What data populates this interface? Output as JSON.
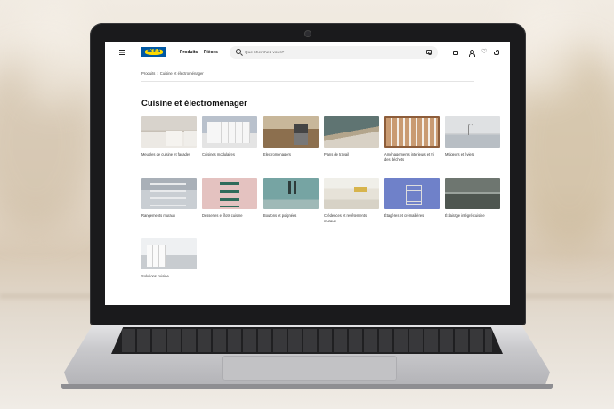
{
  "site": {
    "logo_text": "IKEA",
    "brand_colors": {
      "blue": "#0058a3",
      "yellow": "#ffdb00"
    },
    "nav": [
      {
        "label": "Produits"
      },
      {
        "label": "Pièces"
      }
    ],
    "search": {
      "placeholder": "Que cherchez-vous?"
    },
    "header_icons": [
      "truck-icon",
      "user-icon",
      "heart-icon",
      "shopping-bag-icon"
    ]
  },
  "breadcrumb": {
    "items": [
      "Produits",
      "Cuisine et électroménager"
    ],
    "separator": "›"
  },
  "page": {
    "title": "Cuisine et électroménager"
  },
  "categories": [
    {
      "label": "Meubles de cuisine et façades"
    },
    {
      "label": "Cuisines modulaires"
    },
    {
      "label": "Electroménagers"
    },
    {
      "label": "Plans de travail"
    },
    {
      "label": "Aménagements intérieurs et tri des déchets"
    },
    {
      "label": "Mitigeurs et éviers"
    },
    {
      "label": "Rangements muraux"
    },
    {
      "label": "Dessertes et îlots cuisine"
    },
    {
      "label": "Boutons et poignées"
    },
    {
      "label": "Crédences et revêtements muraux"
    },
    {
      "label": "Étagères et crémaillères"
    },
    {
      "label": "Éclairage intégré cuisine"
    },
    {
      "label": "Solutions cuisine"
    }
  ]
}
